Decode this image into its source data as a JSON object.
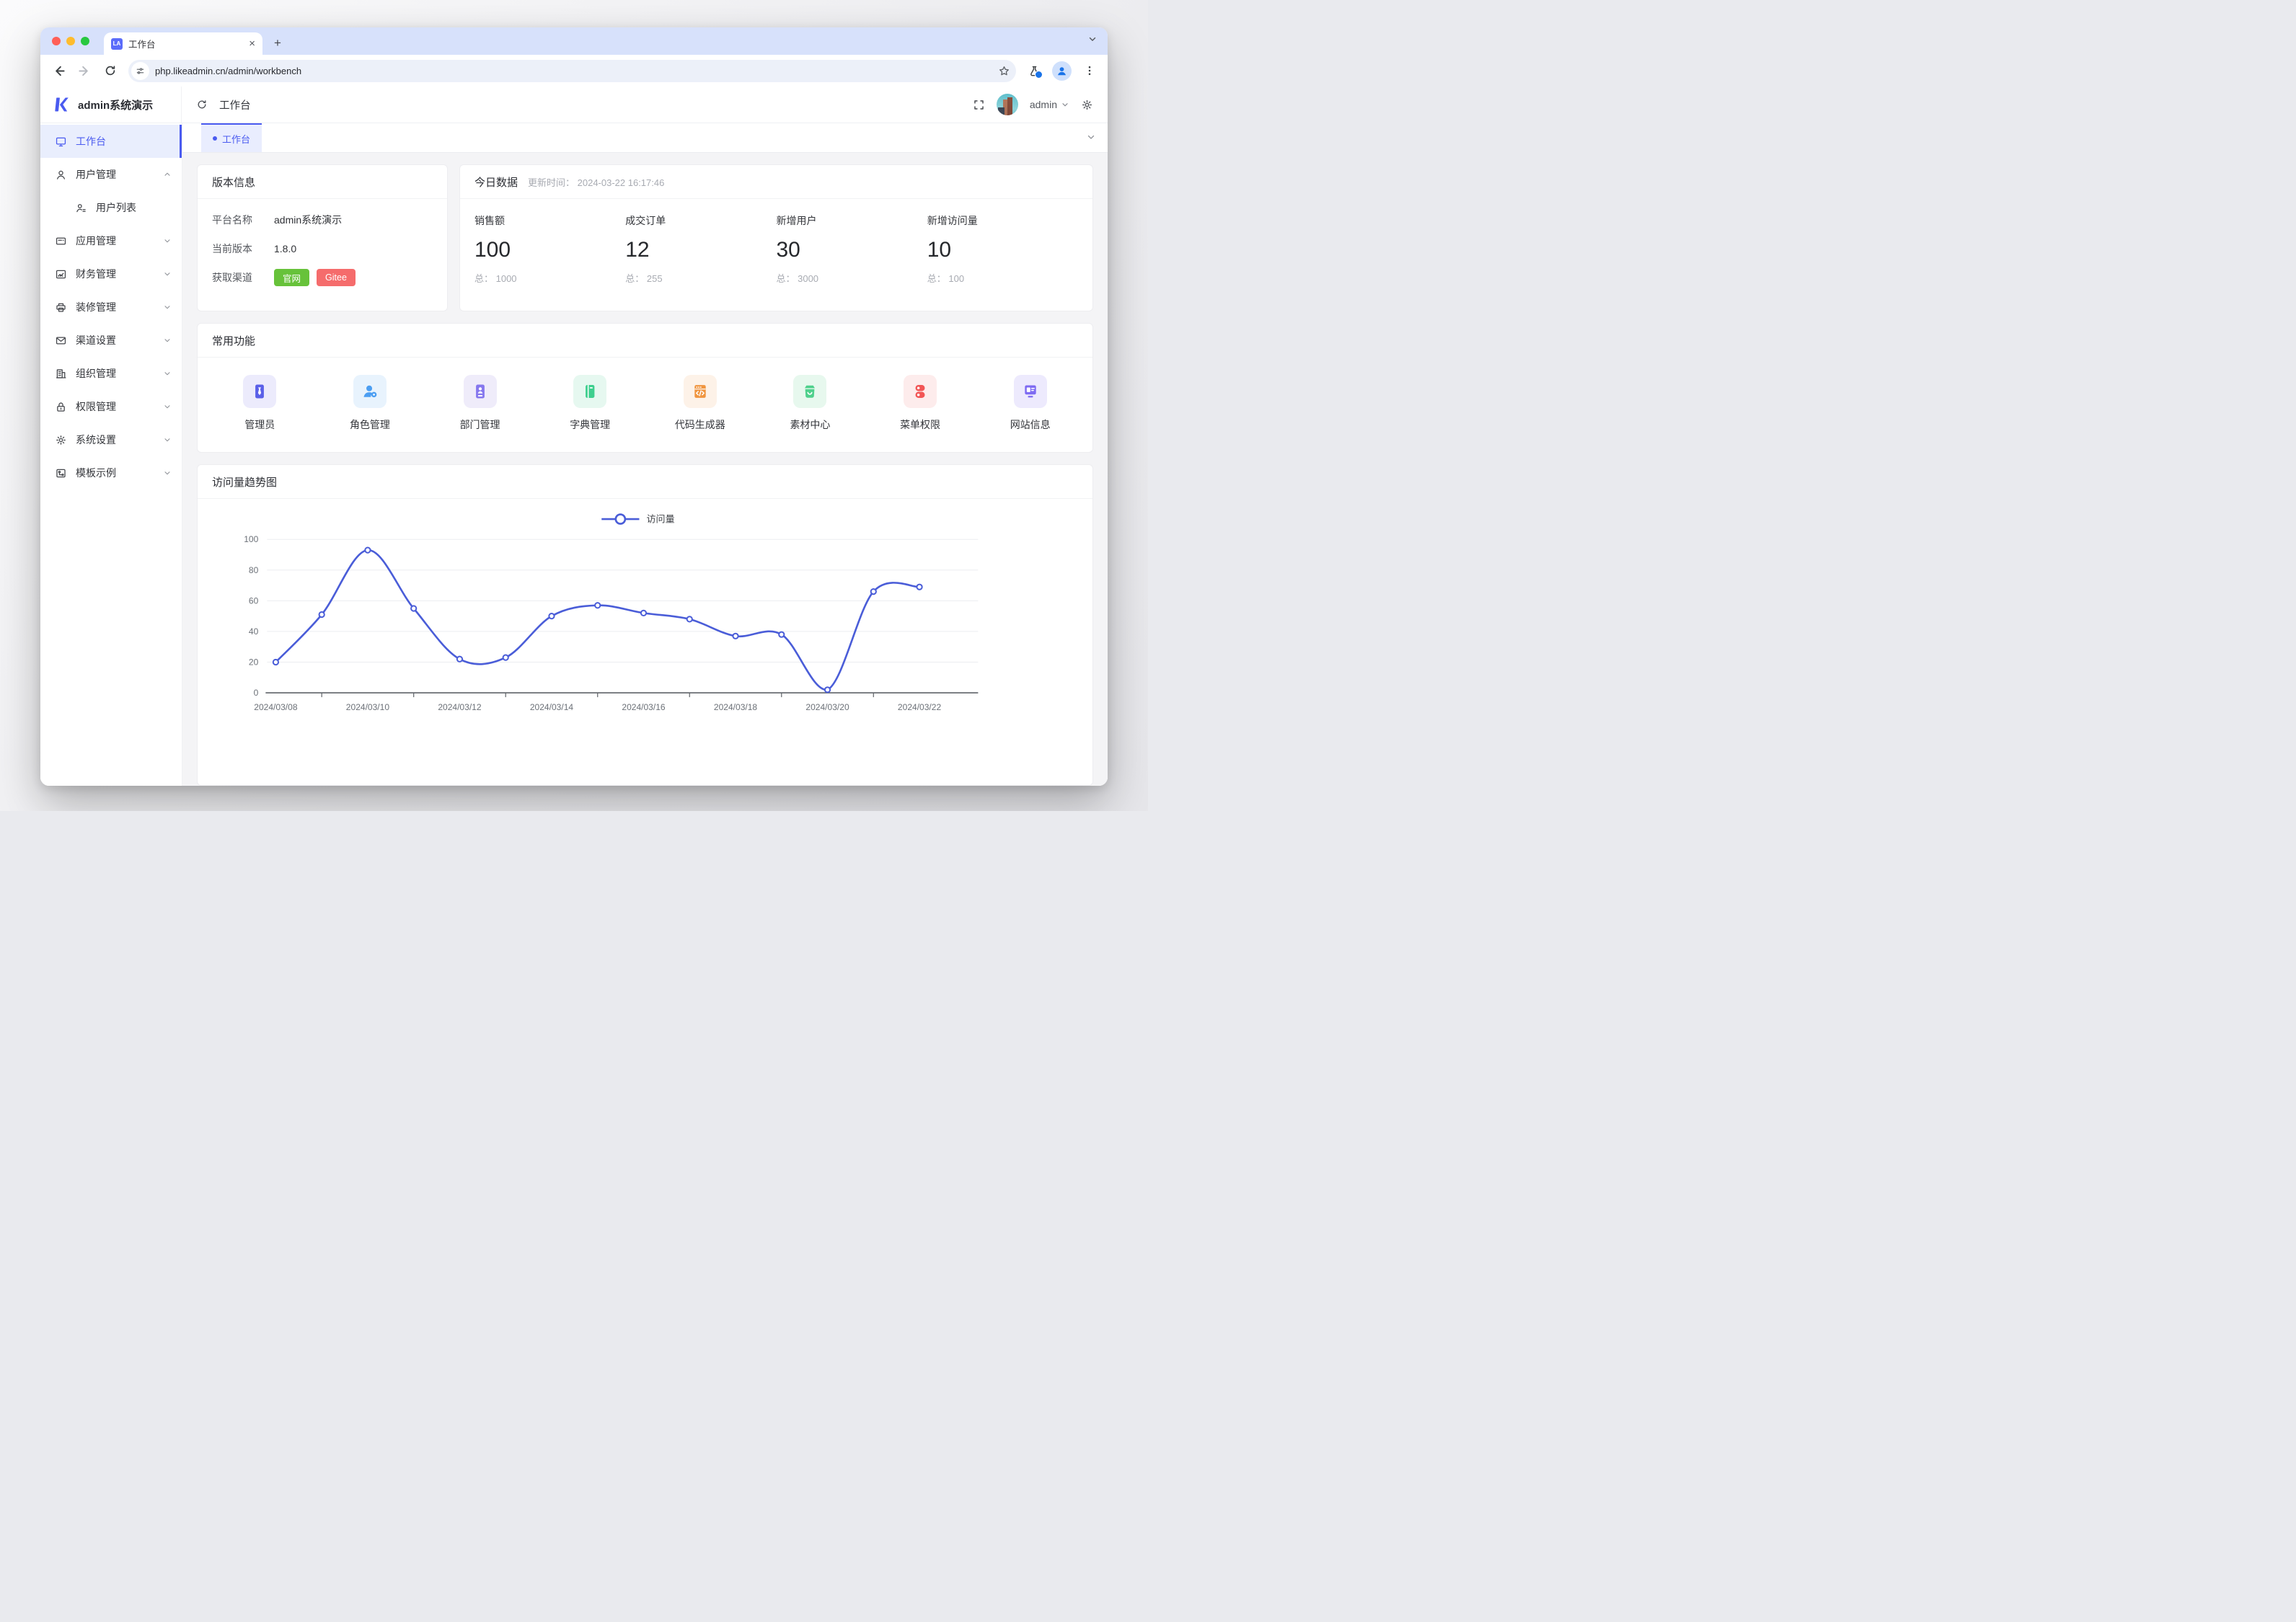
{
  "colors": {
    "accent": "#4a5bf0",
    "chart_line": "#4a5dd8",
    "green_btn": "#67c23a",
    "red_btn": "#f56c6c",
    "tabstrip_bg": "#d7e1fb"
  },
  "browser": {
    "tab_title": "工作台",
    "favicon_text": "LA",
    "close_glyph": "×",
    "new_tab_glyph": "+",
    "url": "php.likeadmin.cn/admin/workbench",
    "icon_names": [
      "back-icon",
      "forward-icon",
      "reload-icon",
      "site-info-icon",
      "bookmark-star-icon",
      "flask-icon",
      "profile-icon",
      "menu-dots-icon",
      "tabstrip-chevron-icon"
    ]
  },
  "header": {
    "brand": "admin系统演示",
    "page_title": "工作台",
    "username": "admin",
    "icon_names": [
      "logo-k-icon",
      "refresh-icon",
      "fullscreen-icon",
      "user-avatar",
      "chevron-down-icon",
      "gear-icon"
    ]
  },
  "sidebar": {
    "items": [
      {
        "label": "工作台",
        "icon": "monitor-icon",
        "active": true,
        "chevron": ""
      },
      {
        "label": "用户管理",
        "icon": "user-icon",
        "chevron": "up",
        "children": [
          {
            "label": "用户列表",
            "icon": "user-list-icon"
          }
        ]
      },
      {
        "label": "应用管理",
        "icon": "app-icon",
        "chevron": "down"
      },
      {
        "label": "财务管理",
        "icon": "finance-icon",
        "chevron": "down"
      },
      {
        "label": "装修管理",
        "icon": "decorate-icon",
        "chevron": "down"
      },
      {
        "label": "渠道设置",
        "icon": "channel-icon",
        "chevron": "down"
      },
      {
        "label": "组织管理",
        "icon": "org-icon",
        "chevron": "down"
      },
      {
        "label": "权限管理",
        "icon": "lock-icon",
        "chevron": "down"
      },
      {
        "label": "系统设置",
        "icon": "gear-icon",
        "chevron": "down"
      },
      {
        "label": "模板示例",
        "icon": "template-icon",
        "chevron": "down"
      }
    ]
  },
  "tabbar": {
    "active_tab": "工作台"
  },
  "version_card": {
    "title": "版本信息",
    "rows": [
      {
        "label": "平台名称",
        "value": "admin系统演示"
      },
      {
        "label": "当前版本",
        "value": "1.8.0"
      }
    ],
    "channel_label": "获取渠道",
    "buttons": [
      {
        "label": "官网",
        "color": "#67c23a"
      },
      {
        "label": "Gitee",
        "color": "#f56c6c"
      }
    ]
  },
  "today_card": {
    "title": "今日数据",
    "updated": "更新时间： 2024-03-22 16:17:46",
    "stats": [
      {
        "label": "销售额",
        "value": "100",
        "total": "总： 1000"
      },
      {
        "label": "成交订单",
        "value": "12",
        "total": "总： 255"
      },
      {
        "label": "新增用户",
        "value": "30",
        "total": "总： 3000"
      },
      {
        "label": "新增访问量",
        "value": "10",
        "total": "总： 100"
      }
    ]
  },
  "quick_card": {
    "title": "常用功能",
    "items": [
      {
        "label": "管理员",
        "icon": "admin-tie-icon",
        "bg": "#ecebfc",
        "fg": "#5a60e8"
      },
      {
        "label": "角色管理",
        "icon": "role-icon",
        "bg": "#e8f3fd",
        "fg": "#4b9ef2"
      },
      {
        "label": "部门管理",
        "icon": "department-icon",
        "bg": "#efecfa",
        "fg": "#8678ee"
      },
      {
        "label": "字典管理",
        "icon": "dict-icon",
        "bg": "#e6f8f0",
        "fg": "#3ecf8e"
      },
      {
        "label": "代码生成器",
        "icon": "codegen-icon",
        "bg": "#fdf2e8",
        "fg": "#f0953f"
      },
      {
        "label": "素材中心",
        "icon": "material-icon",
        "bg": "#e7f8ee",
        "fg": "#4fd08c"
      },
      {
        "label": "菜单权限",
        "icon": "menu-auth-icon",
        "bg": "#fdecec",
        "fg": "#f25555"
      },
      {
        "label": "网站信息",
        "icon": "website-icon",
        "bg": "#edeafd",
        "fg": "#7e6bf2"
      }
    ]
  },
  "chart_card": {
    "title": "访问量趋势图"
  },
  "chart_data": {
    "type": "line",
    "title": "访问量趋势图",
    "legend": [
      {
        "label": "访问量",
        "color": "#4a5dd8",
        "position": "top-center"
      }
    ],
    "x": [
      "2024/03/08",
      "2024/03/09",
      "2024/03/10",
      "2024/03/11",
      "2024/03/12",
      "2024/03/13",
      "2024/03/14",
      "2024/03/15",
      "2024/03/16",
      "2024/03/17",
      "2024/03/18",
      "2024/03/19",
      "2024/03/20",
      "2024/03/21",
      "2024/03/22"
    ],
    "x_tick_labels": [
      "2024/03/08",
      "2024/03/10",
      "2024/03/12",
      "2024/03/14",
      "2024/03/16",
      "2024/03/18",
      "2024/03/20",
      "2024/03/22"
    ],
    "series": [
      {
        "name": "访问量",
        "values": [
          20,
          51,
          93,
          55,
          22,
          23,
          50,
          57,
          52,
          48,
          37,
          38,
          2,
          66,
          69
        ]
      }
    ],
    "ylim": [
      0,
      100
    ],
    "yticks": [
      0,
      20,
      40,
      60,
      80,
      100
    ],
    "smooth": true,
    "grid": "horizontal",
    "marker": "hollow-circle"
  }
}
